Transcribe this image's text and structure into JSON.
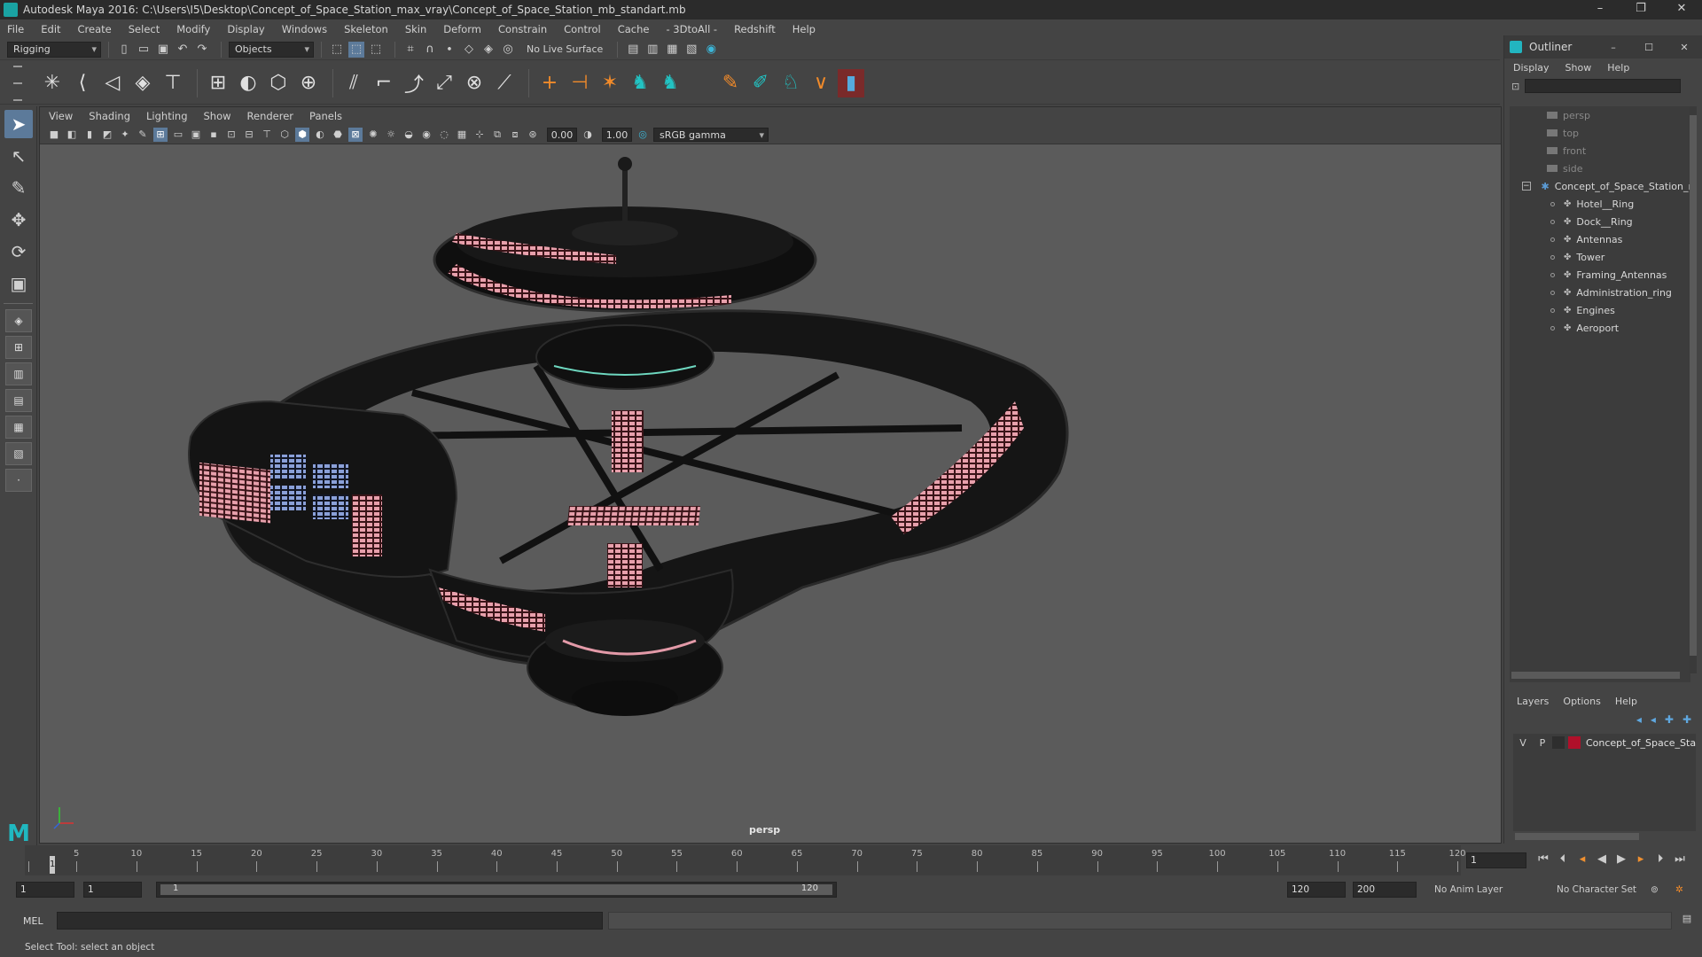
{
  "window": {
    "title": "Autodesk Maya 2016: C:\\Users\\I5\\Desktop\\Concept_of_Space_Station_max_vray\\Concept_of_Space_Station_mb_standart.mb",
    "minimize": "–",
    "maximize": "❐",
    "close": "✕"
  },
  "menubar": [
    "File",
    "Edit",
    "Create",
    "Select",
    "Modify",
    "Display",
    "Windows",
    "Skeleton",
    "Skin",
    "Deform",
    "Constrain",
    "Control",
    "Cache",
    "- 3DtoAll -",
    "Redshift",
    "Help"
  ],
  "statusline": {
    "mode": "Rigging",
    "selection_mode": "Objects",
    "live_surface": "No Live Surface"
  },
  "viewport": {
    "menu": [
      "View",
      "Shading",
      "Lighting",
      "Show",
      "Renderer",
      "Panels"
    ],
    "exposure": "0.00",
    "gamma": "1.00",
    "color_space": "sRGB gamma",
    "camera_label": "persp"
  },
  "outliner": {
    "title": "Outliner",
    "menu": [
      "Display",
      "Show",
      "Help"
    ],
    "cameras": [
      "persp",
      "top",
      "front",
      "side"
    ],
    "root": "Concept_of_Space_Station_n",
    "children": [
      "Hotel__Ring",
      "Dock__Ring",
      "Antennas",
      "Tower",
      "Framing_Antennas",
      "Administration_ring",
      "Engines",
      "Aeroport"
    ]
  },
  "layers": {
    "menu": [
      "Layers",
      "Options",
      "Help"
    ],
    "rows": [
      {
        "v": "V",
        "p": "P",
        "name": "Concept_of_Space_Sta",
        "color": "#b0102a"
      }
    ]
  },
  "timeline": {
    "ticks": [
      1,
      5,
      10,
      15,
      20,
      25,
      30,
      35,
      40,
      45,
      50,
      55,
      60,
      65,
      70,
      75,
      80,
      85,
      90,
      95,
      100,
      105,
      110,
      115,
      120
    ],
    "labels": [
      "5",
      "10",
      "15",
      "20",
      "25",
      "30",
      "35",
      "40",
      "45",
      "50",
      "55",
      "60",
      "65",
      "70",
      "75",
      "80",
      "85",
      "90",
      "95",
      "100",
      "105",
      "110",
      "115",
      "120"
    ],
    "current_frame": "1",
    "current_frame_field": "1"
  },
  "range": {
    "start": "1",
    "playback_start": "1",
    "bar_start": "1",
    "bar_end": "120",
    "playback_end": "120",
    "end": "200",
    "anim_layer": "No Anim Layer",
    "character_set": "No Character Set"
  },
  "cmdline": {
    "mel_label": "MEL"
  },
  "helpline": {
    "text": "Select Tool: select an object"
  }
}
